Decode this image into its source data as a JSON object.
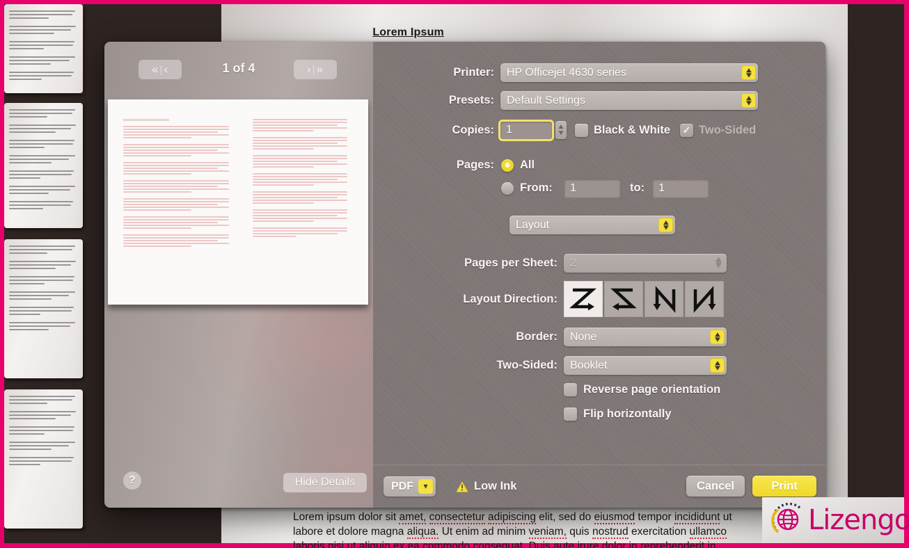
{
  "document": {
    "title": "Lorem Ipsum",
    "body_text": "Lorem ipsum dolor sit amet, consectetur adipiscing elit, sed do eiusmod tempor incididunt ut labore et dolore magna aliqua. Ut enim ad minim veniam, quis nostrud exercitation ullamco laboris nisi ut aliquip ex ea commodo consequat. Duis aute irure dolor in reprehenderit in"
  },
  "preview": {
    "first_page_label": "«",
    "divider": "|",
    "prev_page_label": "‹",
    "next_page_label": "›",
    "last_page_label": "»",
    "page_counter": "1 of 4",
    "help_label": "?",
    "hide_details_label": "Hide Details"
  },
  "settings": {
    "printer": {
      "label": "Printer:",
      "value": "HP Officejet 4630 series"
    },
    "presets": {
      "label": "Presets:",
      "value": "Default Settings"
    },
    "copies": {
      "label": "Copies:",
      "value": "1"
    },
    "black_and_white": {
      "label": "Black & White",
      "checked": false
    },
    "two_sided_top": {
      "label": "Two-Sided",
      "checked": true,
      "disabled": true,
      "check_glyph": "✓"
    },
    "pages": {
      "label": "Pages:",
      "all_label": "All",
      "all_selected": true,
      "from_label": "From:",
      "from_value": "1",
      "to_label": "to:",
      "to_value": "1",
      "range_selected": false
    },
    "pane_selector": {
      "value": "Layout"
    },
    "pages_per_sheet": {
      "label": "Pages per Sheet:",
      "value": "2",
      "disabled": true
    },
    "layout_direction": {
      "label": "Layout Direction:",
      "selected_index": 0,
      "options": [
        "z-right-down",
        "z-left-down",
        "n-down-left",
        "n-down-right"
      ]
    },
    "border": {
      "label": "Border:",
      "value": "None"
    },
    "two_sided": {
      "label": "Two-Sided:",
      "value": "Booklet"
    },
    "reverse_page_orientation": {
      "label": "Reverse page orientation",
      "checked": false
    },
    "flip_horizontally": {
      "label": "Flip horizontally",
      "checked": false
    }
  },
  "actions": {
    "pdf_label": "PDF",
    "pdf_chevron": "▾",
    "low_ink_label": "Low Ink",
    "warning_glyph": "!",
    "cancel_label": "Cancel",
    "print_label": "Print"
  },
  "watermark": {
    "brand": "Lizengo"
  },
  "colors": {
    "accent_yellow": "#f5e13f",
    "brand_magenta": "#c7006b",
    "frame_magenta": "#e8006b",
    "backdrop_brown": "#2e2422",
    "pane_grey": "#837a78"
  }
}
